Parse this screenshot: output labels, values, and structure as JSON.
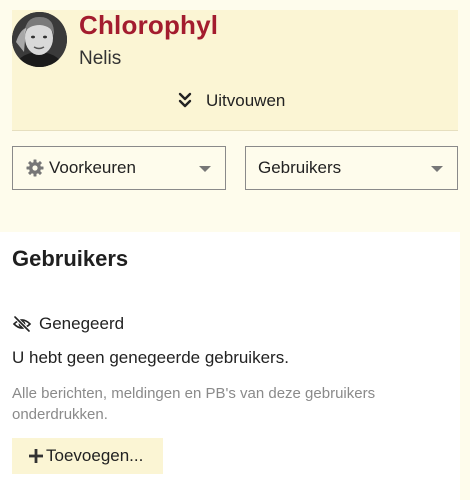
{
  "header": {
    "user_name": "Chlorophyl",
    "user_title": "Nelis",
    "expand_label": "Uitvouwen"
  },
  "nav": {
    "preferences_label": "Voorkeuren",
    "users_label": "Gebruikers"
  },
  "section": {
    "title": "Gebruikers",
    "ignored_heading": "Genegeerd",
    "empty_message": "U hebt geen genegeerde gebruikers.",
    "helper_text": "Alle berichten, meldingen en PB's van deze gebruikers onderdrukken.",
    "add_label": "Toevoegen..."
  },
  "colors": {
    "accent": "#a31c2e",
    "header_bg": "#fbf5d4",
    "page_bg": "#fefcec",
    "panel_bg": "#ffffff",
    "muted_text": "#8a8a8a"
  },
  "icons": {
    "expand": "double-chevron-down-icon",
    "preferences": "gear-icon",
    "ignored": "eye-slash-icon",
    "add": "plus-icon"
  }
}
